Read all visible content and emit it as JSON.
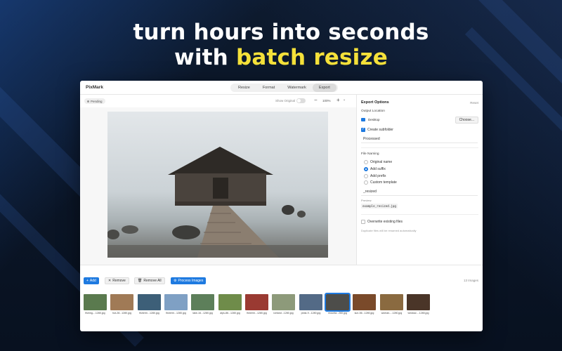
{
  "marketing": {
    "line1": "turn hours into seconds",
    "line2_prefix": "with ",
    "line2_highlight": "batch resize",
    "highlight_color": "#f5e13a"
  },
  "window": {
    "app_name": "PixMark",
    "tabs": [
      {
        "label": "Resize",
        "active": false
      },
      {
        "label": "Format",
        "active": false
      },
      {
        "label": "Watermark",
        "active": false
      },
      {
        "label": "Export",
        "active": true
      }
    ]
  },
  "preview": {
    "status_badge": "Pending",
    "show_original_label": "Show Original",
    "show_original_on": false,
    "zoom_minus": "−",
    "zoom_value": "100%",
    "zoom_plus": "+",
    "zoom_menu": "⌄"
  },
  "export_options": {
    "title": "Export Options",
    "reset_label": "Reset",
    "output_location_label": "Output Location",
    "folder_name": "Desktop",
    "choose_label": "Choose...",
    "create_subfolder_label": "Create subfolder",
    "create_subfolder_checked": true,
    "subfolder_name": "Processed",
    "file_naming_label": "File Naming",
    "naming_options": [
      {
        "label": "Original name",
        "selected": false
      },
      {
        "label": "Add suffix",
        "selected": true
      },
      {
        "label": "Add prefix",
        "selected": false
      },
      {
        "label": "Custom template",
        "selected": false
      }
    ],
    "suffix_value": "_resized",
    "preview_label": "Preview:",
    "preview_filename": "example_resized.jpg",
    "overwrite_label": "Overwrite existing files",
    "overwrite_checked": false,
    "overwrite_note": "Duplicate files will be renamed automatically"
  },
  "toolbar": {
    "add_label": "Add",
    "remove_label": "Remove",
    "remove_all_label": "Remove All",
    "process_label": "Process Images",
    "image_count": "13 Images"
  },
  "thumbnails": [
    {
      "name": "fishing-...1280.jpg",
      "color": "#5a7a4e"
    },
    {
      "name": "hut-28...1280.jpg",
      "color": "#a07a56"
    },
    {
      "name": "fisherm...1280.jpg",
      "color": "#3d5f78"
    },
    {
      "name": "fisherm...1280.jpg",
      "color": "#7fa0c4"
    },
    {
      "name": "lake-16...1280.jpg",
      "color": "#5d7f5a"
    },
    {
      "name": "alps-86...1280.jpg",
      "color": "#6f8c4a"
    },
    {
      "name": "fisherm...1280.jpg",
      "color": "#9a3a32"
    },
    {
      "name": "iceland...1280.jpg",
      "color": "#8d9a7a"
    },
    {
      "name": "peak-9...1280.jpg",
      "color": "#536a86"
    },
    {
      "name": "mounta...260.jpg",
      "color": "#4d4d4a",
      "selected": true
    },
    {
      "name": "sun-56...1280.jpg",
      "color": "#7a4a2a"
    },
    {
      "name": "woman-...1280.jpg",
      "color": "#8a6a40"
    },
    {
      "name": "window-...1280.jpg",
      "color": "#4a3528"
    }
  ]
}
